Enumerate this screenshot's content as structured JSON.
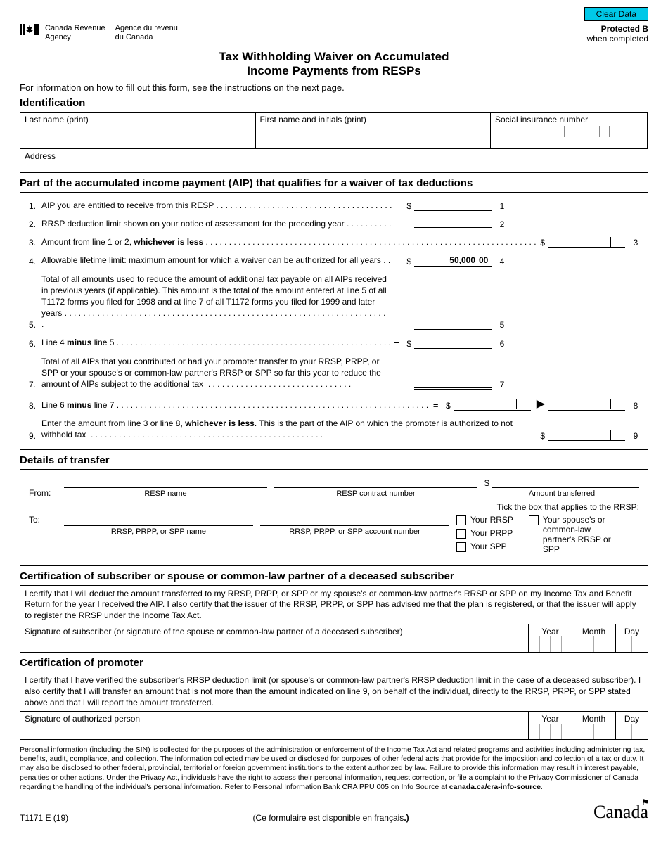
{
  "buttons": {
    "clear": "Clear Data"
  },
  "header": {
    "agency_en_1": "Canada Revenue",
    "agency_en_2": "Agency",
    "agency_fr_1": "Agence du revenu",
    "agency_fr_2": "du Canada",
    "protected_b": "Protected B",
    "when_completed": "when completed"
  },
  "title_1": "Tax Withholding Waiver on Accumulated",
  "title_2": "Income Payments from RESPs",
  "intro": "For information on how to fill out this form, see the instructions on the next page.",
  "sections": {
    "identification": "Identification",
    "aip": "Part of the accumulated income payment (AIP) that qualifies for a waiver of tax deductions",
    "transfer": "Details of transfer",
    "cert_sub": "Certification of subscriber or spouse or common-law partner of a deceased subscriber",
    "cert_prom": "Certification of promoter"
  },
  "id_labels": {
    "last": "Last name (print)",
    "first": "First name and initials (print)",
    "sin": "Social insurance number",
    "address": "Address"
  },
  "lines": {
    "l1": "AIP you are entitled to receive from this RESP",
    "l2": "RRSP deduction limit shown on your notice of assessment for the preceding year",
    "l3_a": "Amount from line 1 or 2, ",
    "l3_b": "whichever is less",
    "l4_a": "Allowable lifetime limit: maximum amount for which a waiver can be authorized for all years",
    "l4_val_whole": "50,000",
    "l4_val_cents": "00",
    "l5": "Total of all amounts used to reduce the amount of additional tax payable on all AIPs received in previous years (if applicable). This amount is the total of the amount entered at line 5 of all T1172 forms you filed for 1998 and at line 7 of all T1172 forms you filed for 1999 and later years",
    "l6_a": "Line 4 ",
    "l6_b": "minus",
    "l6_c": " line 5",
    "l7": "Total of all AIPs that you contributed or had your promoter transfer to your RRSP, PRPP, or SPP or your spouse's or common-law partner's RRSP or SPP so far this year to reduce the amount of AIPs subject to the additional tax",
    "l8_a": "Line 6 ",
    "l8_b": "minus",
    "l8_c": " line 7",
    "l9_a": "Enter the amount from line 3 or line 8, ",
    "l9_b": "whichever is less",
    "l9_c": ". This is the part of the AIP on which the promoter is authorized to not withhold tax"
  },
  "transfer": {
    "from": "From:",
    "to": "To:",
    "resp_name": "RESP name",
    "resp_contract": "RESP contract number",
    "amount_transferred": "Amount transferred",
    "rrsp_name": "RRSP, PRPP, or SPP name",
    "rrsp_account": "RRSP, PRPP, or SPP account number",
    "tick": "Tick the box that applies to the RRSP:",
    "your_rrsp": "Your RRSP",
    "your_prpp": "Your PRPP",
    "your_spp": "Your SPP",
    "spouse": "Your spouse's or common-law partner's RRSP or SPP"
  },
  "cert_sub_text": "I certify that I will deduct the amount transferred to my RRSP, PRPP, or SPP or my spouse's or common-law partner's RRSP or SPP on my Income Tax and Benefit Return for the year I received the AIP. I also certify that the issuer of the RRSP, PRPP, or SPP has advised me that the plan is registered, or that the issuer will apply to register the RRSP under the Income Tax Act.",
  "cert_sub_sig": "Signature of subscriber (or signature of the spouse or common-law partner of a deceased subscriber)",
  "cert_prom_text": "I certify that I have verified the subscriber's RRSP deduction limit (or spouse's or common-law partner's RRSP deduction limit in the case of a deceased subscriber). I also certify that I will transfer an amount that is not more than the amount indicated on line 9, on behalf of the individual, directly to the RRSP, PRPP, or SPP stated above and that I will report the amount transferred.",
  "cert_prom_sig": "Signature of authorized person",
  "date": {
    "year": "Year",
    "month": "Month",
    "day": "Day"
  },
  "fineprint_a": "Personal information (including the SIN) is collected for the purposes of the administration or enforcement of the Income Tax Act and related programs and activities including administering tax, benefits, audit, compliance, and collection. The information collected may be used or disclosed for purposes of other federal acts that provide for the imposition and collection of a tax or duty. It may also be disclosed to other federal, provincial, territorial or foreign government institutions to the extent authorized by law. Failure to provide this information may result in interest payable, penalties or other actions. Under the Privacy Act, individuals have the right to access their personal information, request correction, or file a complaint to the Privacy Commissioner of Canada regarding the handling of the individual's personal information. Refer to Personal Information Bank CRA PPU 005 on Info Source at ",
  "fineprint_b": "canada.ca/cra-info-source",
  "footer": {
    "code": "T1171 E (19)",
    "center_a": "(Ce formulaire est disponible en français",
    "center_b": ".)",
    "wordmark": "Canadä"
  }
}
